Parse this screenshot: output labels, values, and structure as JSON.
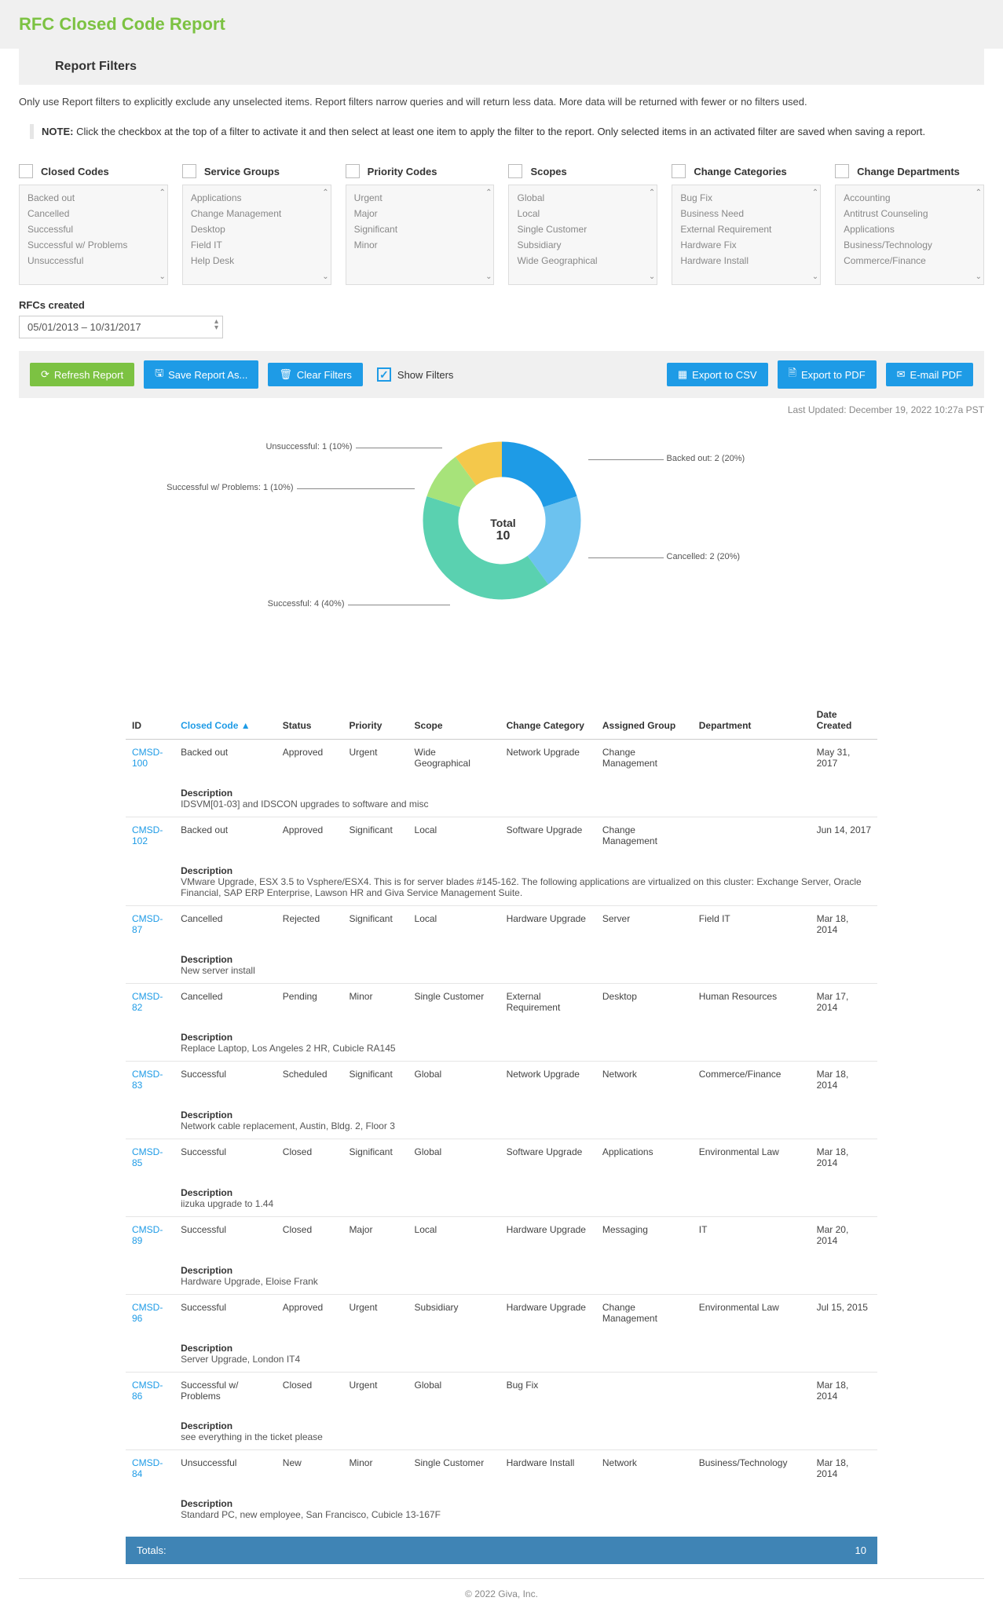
{
  "page_title": "RFC Closed Code Report",
  "section_title": "Report Filters",
  "filter_help": "Only use Report filters to explicitly exclude any unselected items. Report filters narrow queries and will return less data. More data will be returned with fewer or no filters used.",
  "filter_note_label": "NOTE:",
  "filter_note": "Click the checkbox at the top of a filter to activate it and then select at least one item to apply the filter to the report. Only selected items in an activated filter are saved when saving a report.",
  "filters": {
    "closed_codes": {
      "label": "Closed Codes",
      "items": [
        "Backed out",
        "Cancelled",
        "Successful",
        "Successful w/ Problems",
        "Unsuccessful"
      ]
    },
    "service_groups": {
      "label": "Service Groups",
      "items": [
        "Applications",
        "Change Management",
        "Desktop",
        "Field IT",
        "Help Desk"
      ]
    },
    "priority_codes": {
      "label": "Priority Codes",
      "items": [
        "Urgent",
        "Major",
        "Significant",
        "Minor"
      ]
    },
    "scopes": {
      "label": "Scopes",
      "items": [
        "Global",
        "Local",
        "Single Customer",
        "Subsidiary",
        "Wide Geographical"
      ]
    },
    "change_categories": {
      "label": "Change Categories",
      "items": [
        "Bug Fix",
        "Business Need",
        "External Requirement",
        "Hardware Fix",
        "Hardware Install"
      ]
    },
    "change_departments": {
      "label": "Change Departments",
      "items": [
        "Accounting",
        "Antitrust Counseling",
        "Applications",
        "Business/Technology",
        "Commerce/Finance"
      ]
    }
  },
  "date_filter": {
    "label": "RFCs created",
    "value": "05/01/2013 – 10/31/2017"
  },
  "actions": {
    "refresh": "Refresh Report",
    "save_as": "Save Report As...",
    "clear_filters": "Clear Filters",
    "show_filters": "Show Filters",
    "export_csv": "Export to CSV",
    "export_pdf": "Export to PDF",
    "email_pdf": "E-mail PDF"
  },
  "last_updated": "Last Updated: December 19, 2022 10:27a PST",
  "chart_data": {
    "type": "pie",
    "title": "",
    "categories": [
      "Backed out",
      "Cancelled",
      "Successful",
      "Successful w/ Problems",
      "Unsuccessful"
    ],
    "values": [
      2,
      2,
      4,
      1,
      1
    ],
    "percents": [
      20,
      20,
      40,
      10,
      10
    ],
    "colors": [
      "#1e9be6",
      "#6cc2ef",
      "#5ad1b0",
      "#a7e37a",
      "#f4c84b"
    ],
    "total_label": "Total",
    "total_value": 10,
    "labels": [
      "Backed out: 2 (20%)",
      "Cancelled: 2 (20%)",
      "Successful: 4 (40%)",
      "Successful w/ Problems: 1 (10%)",
      "Unsuccessful: 1 (10%)"
    ]
  },
  "table": {
    "headers": [
      "ID",
      "Closed Code",
      "Status",
      "Priority",
      "Scope",
      "Change Category",
      "Assigned Group",
      "Department",
      "Date Created"
    ],
    "sort_col": 1,
    "sort_indicator": "▲",
    "desc_header": "Description",
    "totals_label": "Totals:",
    "totals_value": "10",
    "rows": [
      {
        "id": "CMSD-100",
        "closed": "Backed out",
        "status": "Approved",
        "priority": "Urgent",
        "scope": "Wide Geographical",
        "category": "Network Upgrade",
        "group": "Change Management",
        "dept": "",
        "date": "May 31, 2017",
        "desc": "IDSVM[01-03] and IDSCON upgrades to software and misc"
      },
      {
        "id": "CMSD-102",
        "closed": "Backed out",
        "status": "Approved",
        "priority": "Significant",
        "scope": "Local",
        "category": "Software Upgrade",
        "group": "Change Management",
        "dept": "",
        "date": "Jun 14, 2017",
        "desc": "VMware Upgrade, ESX 3.5 to Vsphere/ESX4. This is for server blades #145-162. The following applications are virtualized on this cluster: Exchange Server, Oracle Financial, SAP ERP Enterprise, Lawson HR and Giva Service Management Suite."
      },
      {
        "id": "CMSD-87",
        "closed": "Cancelled",
        "status": "Rejected",
        "priority": "Significant",
        "scope": "Local",
        "category": "Hardware Upgrade",
        "group": "Server",
        "dept": "Field IT",
        "date": "Mar 18, 2014",
        "desc": "New server install"
      },
      {
        "id": "CMSD-82",
        "closed": "Cancelled",
        "status": "Pending",
        "priority": "Minor",
        "scope": "Single Customer",
        "category": "External Requirement",
        "group": "Desktop",
        "dept": "Human Resources",
        "date": "Mar 17, 2014",
        "desc": "Replace Laptop, Los Angeles 2 HR, Cubicle RA145"
      },
      {
        "id": "CMSD-83",
        "closed": "Successful",
        "status": "Scheduled",
        "priority": "Significant",
        "scope": "Global",
        "category": "Network Upgrade",
        "group": "Network",
        "dept": "Commerce/Finance",
        "date": "Mar 18, 2014",
        "desc": "Network cable replacement, Austin, Bldg. 2, Floor 3"
      },
      {
        "id": "CMSD-85",
        "closed": "Successful",
        "status": "Closed",
        "priority": "Significant",
        "scope": "Global",
        "category": "Software Upgrade",
        "group": "Applications",
        "dept": "Environmental Law",
        "date": "Mar 18, 2014",
        "desc": "iizuka upgrade to 1.44"
      },
      {
        "id": "CMSD-89",
        "closed": "Successful",
        "status": "Closed",
        "priority": "Major",
        "scope": "Local",
        "category": "Hardware Upgrade",
        "group": "Messaging",
        "dept": "IT",
        "date": "Mar 20, 2014",
        "desc": "Hardware Upgrade, Eloise Frank"
      },
      {
        "id": "CMSD-96",
        "closed": "Successful",
        "status": "Approved",
        "priority": "Urgent",
        "scope": "Subsidiary",
        "category": "Hardware Upgrade",
        "group": "Change Management",
        "dept": "Environmental Law",
        "date": "Jul 15, 2015",
        "desc": "Server Upgrade, London IT4"
      },
      {
        "id": "CMSD-86",
        "closed": "Successful w/ Problems",
        "status": "Closed",
        "priority": "Urgent",
        "scope": "Global",
        "category": "Bug Fix",
        "group": "",
        "dept": "",
        "date": "Mar 18, 2014",
        "desc": "see everything in the ticket please"
      },
      {
        "id": "CMSD-84",
        "closed": "Unsuccessful",
        "status": "New",
        "priority": "Minor",
        "scope": "Single Customer",
        "category": "Hardware Install",
        "group": "Network",
        "dept": "Business/Technology",
        "date": "Mar 18, 2014",
        "desc": "Standard PC, new employee, San Francisco, Cubicle 13-167F"
      }
    ]
  },
  "footer": "© 2022 Giva, Inc."
}
